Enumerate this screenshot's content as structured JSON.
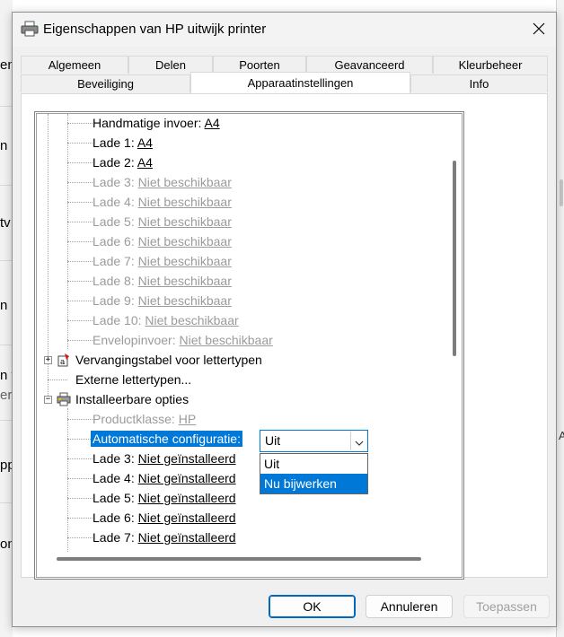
{
  "background": {
    "fragments": [
      "en",
      "n",
      "tv",
      "n",
      "n v",
      "erd",
      "pp",
      "on"
    ]
  },
  "window": {
    "title": "Eigenschappen van HP uitwijk printer",
    "close_glyph": "✕"
  },
  "tabs": {
    "row1": [
      "Algemeen",
      "Delen",
      "Poorten",
      "Geavanceerd",
      "Kleurbeheer"
    ],
    "row2": [
      "Beveiliging",
      "Apparaatinstellingen",
      "Info"
    ],
    "active": "Apparaatinstellingen"
  },
  "tree": {
    "trays": [
      {
        "label": "Handmatige invoer:",
        "value": "A4",
        "disabled": false
      },
      {
        "label": "Lade 1:",
        "value": "A4",
        "disabled": false
      },
      {
        "label": "Lade 2:",
        "value": "A4",
        "disabled": false
      },
      {
        "label": "Lade 3:",
        "value": "Niet beschikbaar",
        "disabled": true
      },
      {
        "label": "Lade 4:",
        "value": "Niet beschikbaar",
        "disabled": true
      },
      {
        "label": "Lade 5:",
        "value": "Niet beschikbaar",
        "disabled": true
      },
      {
        "label": "Lade 6:",
        "value": "Niet beschikbaar",
        "disabled": true
      },
      {
        "label": "Lade 7:",
        "value": "Niet beschikbaar",
        "disabled": true
      },
      {
        "label": "Lade 8:",
        "value": "Niet beschikbaar",
        "disabled": true
      },
      {
        "label": "Lade 9:",
        "value": "Niet beschikbaar",
        "disabled": true
      },
      {
        "label": "Lade 10:",
        "value": "Niet beschikbaar",
        "disabled": true
      },
      {
        "label": "Envelopinvoer:",
        "value": "Niet beschikbaar",
        "disabled": true
      }
    ],
    "font_substitution": "Vervangingstabel voor lettertypen",
    "external_fonts": "Externe lettertypen...",
    "installable_options": "Installeerbare opties",
    "product_class": {
      "label": "Productklasse:",
      "value": "HP"
    },
    "auto_config": {
      "label": "Automatische configuratie:",
      "value": "Uit"
    },
    "installed_trays": [
      {
        "label": "Lade 3:",
        "value": "Niet geïnstalleerd"
      },
      {
        "label": "Lade 4:",
        "value": "Niet geïnstalleerd"
      },
      {
        "label": "Lade 5:",
        "value": "Niet geïnstalleerd"
      },
      {
        "label": "Lade 6:",
        "value": "Niet geïnstalleerd"
      },
      {
        "label": "Lade 7:",
        "value": "Niet geïnstalleerd"
      }
    ],
    "dropdown_options": [
      "Uit",
      "Nu bijwerken"
    ],
    "dropdown_highlighted": "Nu bijwerken"
  },
  "buttons": {
    "ok": "OK",
    "cancel": "Annuleren",
    "apply": "Toepassen"
  },
  "icons": {
    "title": "printer-icon",
    "close": "close-icon",
    "font_table": "font-table-icon",
    "installable": "printer-options-icon",
    "combo_arrow": "chevron-down-icon"
  },
  "colors": {
    "accent": "#0078d7",
    "disabled_text": "#9b9b9b"
  }
}
